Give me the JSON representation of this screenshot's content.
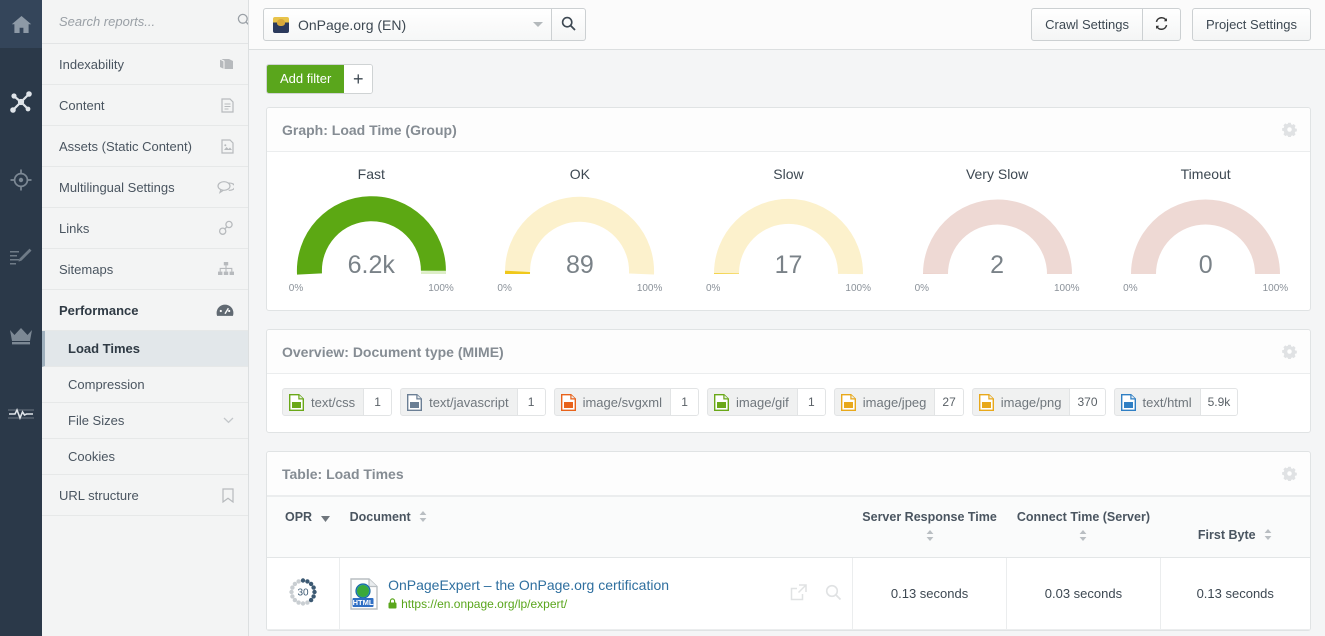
{
  "rail": {
    "items": [
      {
        "name": "home-icon",
        "label": "Home",
        "active": true
      },
      {
        "name": "network-icon",
        "label": "Projects",
        "active": false
      },
      {
        "name": "target-icon",
        "label": "Rankings",
        "active": false
      },
      {
        "name": "edit-icon",
        "label": "Content",
        "active": false
      },
      {
        "name": "crown-icon",
        "label": "Premium",
        "active": false
      },
      {
        "name": "pulse-icon",
        "label": "Monitoring",
        "active": false
      }
    ]
  },
  "topbar": {
    "project_name": "OnPage.org (EN)",
    "search_icon": "search-icon",
    "dropdown_icon": "chevron-down-icon",
    "crawl_settings_label": "Crawl Settings",
    "refresh_icon": "refresh-icon",
    "project_settings_label": "Project Settings"
  },
  "filterbar": {
    "add_filter_label": "Add filter",
    "add_filter_plus": "+"
  },
  "sidebar": {
    "search_placeholder": "Search reports...",
    "search_value": "",
    "search_icon": "search-icon",
    "items": [
      {
        "label": "Indexability",
        "icon": "book-icon",
        "type": "item"
      },
      {
        "label": "Content",
        "icon": "document-icon",
        "type": "item"
      },
      {
        "label": "Assets (Static Content)",
        "icon": "image-file-icon",
        "type": "item"
      },
      {
        "label": "Multilingual Settings",
        "icon": "speech-bubbles-icon",
        "type": "item"
      },
      {
        "label": "Links",
        "icon": "link-icon",
        "type": "item"
      },
      {
        "label": "Sitemaps",
        "icon": "sitemap-icon",
        "type": "item"
      },
      {
        "label": "Performance",
        "icon": "gauge-icon",
        "type": "group-open"
      },
      {
        "label": "Load Times",
        "icon": "",
        "type": "sub-active"
      },
      {
        "label": "Compression",
        "icon": "",
        "type": "sub"
      },
      {
        "label": "File Sizes",
        "icon": "chevron-down-icon",
        "type": "sub"
      },
      {
        "label": "Cookies",
        "icon": "",
        "type": "sub"
      },
      {
        "label": "URL structure",
        "icon": "bookmark-icon",
        "type": "item"
      }
    ]
  },
  "graph_panel": {
    "title": "Graph: Load Time (Group)",
    "gear_icon": "gear-icon",
    "scale_min": "0%",
    "scale_max": "100%"
  },
  "mime_panel": {
    "title": "Overview: Document type (MIME)",
    "gear_icon": "gear-icon",
    "badges": [
      {
        "name": "text/css",
        "count": "1",
        "color": "#6aa818"
      },
      {
        "name": "text/javascript",
        "count": "1",
        "color": "#6b7f95"
      },
      {
        "name": "image/svgxml",
        "count": "1",
        "color": "#e8621a"
      },
      {
        "name": "image/gif",
        "count": "1",
        "color": "#6aa818"
      },
      {
        "name": "image/jpeg",
        "count": "27",
        "color": "#e8a81a"
      },
      {
        "name": "image/png",
        "count": "370",
        "color": "#e8a81a"
      },
      {
        "name": "text/html",
        "count": "5.9k",
        "color": "#2f7fc4"
      }
    ]
  },
  "table_panel": {
    "title": "Table: Load Times",
    "gear_icon": "gear-icon",
    "columns": [
      {
        "label": "OPR",
        "sort": "desc",
        "align": "left"
      },
      {
        "label": "Document",
        "sort": "none",
        "align": "left"
      },
      {
        "label": "",
        "sort": "",
        "align": "center"
      },
      {
        "label": "Server Response Time",
        "sort": "none",
        "align": "center"
      },
      {
        "label": "Connect Time (Server)",
        "sort": "none",
        "align": "center"
      },
      {
        "label": "First Byte",
        "sort": "none",
        "align": "center"
      }
    ],
    "rows": [
      {
        "opr": "30",
        "opr_fill": 0.45,
        "doc_icon": "html-file-icon",
        "doc_title": "OnPageExpert – the OnPage.org certification",
        "doc_url": "https://en.onpage.org/lp/expert/",
        "lock_icon": "lock-icon",
        "open_icon": "external-link-icon",
        "inspect_icon": "magnifier-icon",
        "server_response_time": "0.13 seconds",
        "connect_time_server": "0.03 seconds",
        "first_byte": "0.13 seconds"
      }
    ]
  },
  "chart_data": {
    "type": "gauge",
    "title": "Graph: Load Time (Group)",
    "axis_min_label": "0%",
    "axis_max_label": "100%",
    "xlim": [
      0,
      100
    ],
    "gauges": [
      {
        "label": "Fast",
        "value": "6.2k",
        "numeric": 6200,
        "percent": 98.3,
        "fill_color": "#5ca813",
        "track_color": "#ddeec7"
      },
      {
        "label": "OK",
        "value": "89",
        "numeric": 89,
        "percent": 1.4,
        "fill_color": "#f0c81a",
        "track_color": "#fcf1cc"
      },
      {
        "label": "Slow",
        "value": "17",
        "numeric": 17,
        "percent": 0.3,
        "fill_color": "#f0c81a",
        "track_color": "#fcf1cc"
      },
      {
        "label": "Very Slow",
        "value": "2",
        "numeric": 2,
        "percent": 0.03,
        "fill_color": "#e0a59a",
        "track_color": "#eed9d4"
      },
      {
        "label": "Timeout",
        "value": "0",
        "numeric": 0,
        "percent": 0,
        "fill_color": "#e0a59a",
        "track_color": "#eed9d4"
      }
    ]
  }
}
